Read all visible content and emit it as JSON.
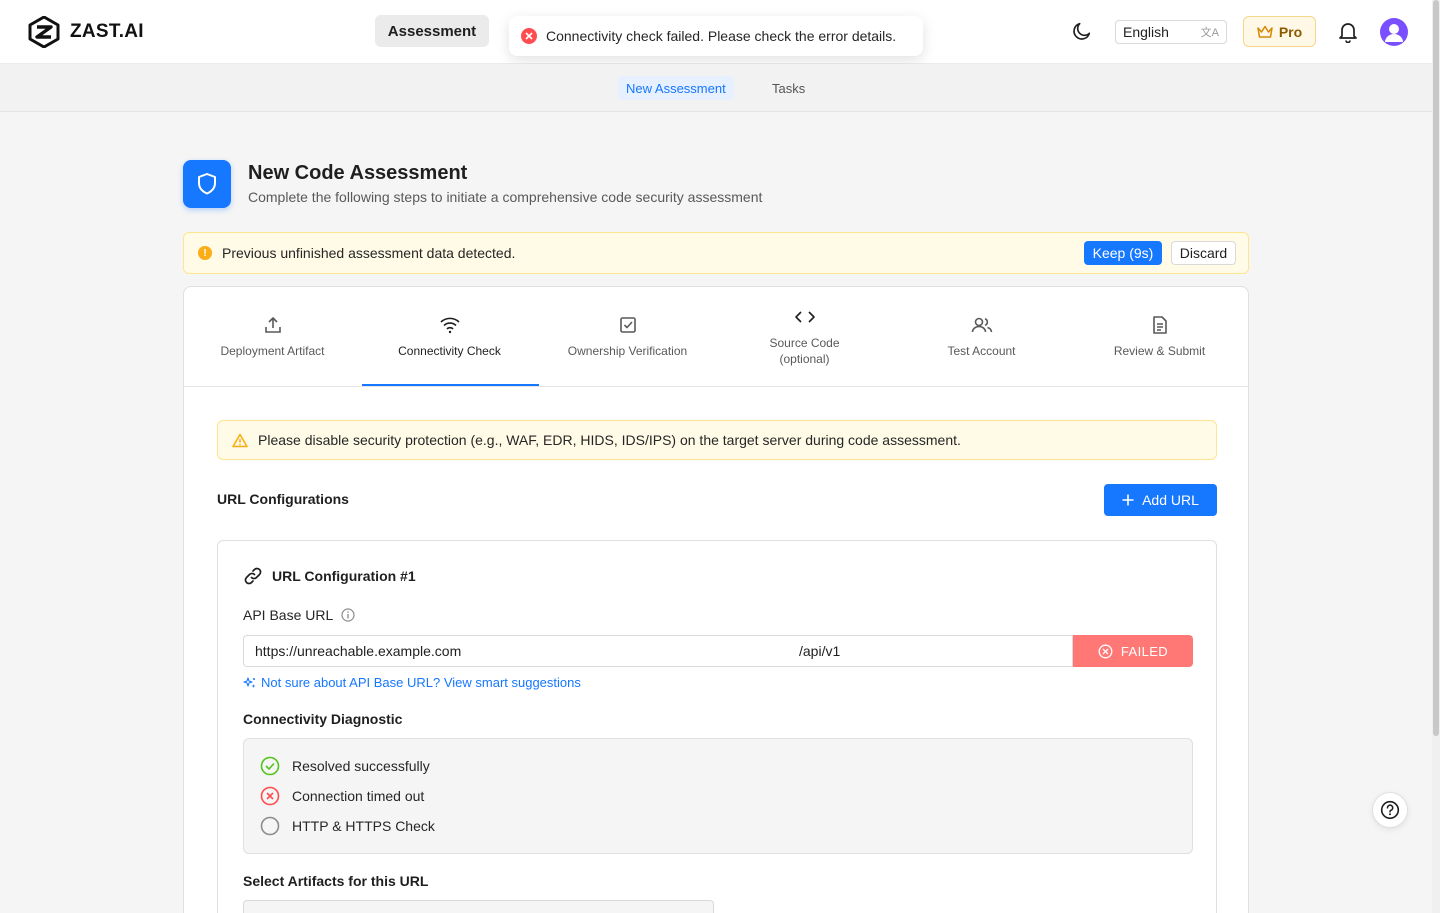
{
  "app": {
    "logo_text": "ZAST.AI"
  },
  "header": {
    "nav_button": "Assessment",
    "toast": "Connectivity check failed. Please check the error details.",
    "language": "English",
    "pro_label": "Pro"
  },
  "subnav": {
    "tabs": [
      {
        "label": "New Assessment"
      },
      {
        "label": "Tasks"
      }
    ]
  },
  "page": {
    "title": "New Code Assessment",
    "subtitle": "Complete the following steps to initiate a comprehensive code security assessment"
  },
  "banner": {
    "message": "Previous unfinished assessment data detected.",
    "keep_label": "Keep (9s)",
    "discard_label": "Discard"
  },
  "steps": [
    {
      "label": "Deployment Artifact",
      "icon": "upload-icon"
    },
    {
      "label": "Connectivity Check",
      "icon": "wifi-icon"
    },
    {
      "label": "Ownership Verification",
      "icon": "checkbox-icon"
    },
    {
      "label": "Source Code\n(optional)",
      "icon": "code-icon"
    },
    {
      "label": "Test Account",
      "icon": "users-icon"
    },
    {
      "label": "Review & Submit",
      "icon": "document-icon"
    }
  ],
  "alert": {
    "message": "Please disable security protection (e.g., WAF, EDR, HIDS, IDS/IPS) on the target server during code assessment."
  },
  "url_config": {
    "section_title": "URL Configurations",
    "add_label": "Add URL",
    "card_title": "URL Configuration #1",
    "base_url_label": "API Base URL",
    "base_url_value": "https://unreachable.example.com",
    "path_value": "/api/v1",
    "status_label": "FAILED",
    "suggest_link": "Not sure about API Base URL? View smart suggestions",
    "diagnostic_title": "Connectivity Diagnostic",
    "diagnostics": [
      {
        "label": "Resolved successfully",
        "status": "success"
      },
      {
        "label": "Connection timed out",
        "status": "error"
      },
      {
        "label": "HTTP & HTTPS Check",
        "status": "pending"
      }
    ],
    "artifacts_title": "Select Artifacts for this URL"
  },
  "colors": {
    "primary": "#1677ff",
    "error": "#ff4d4f",
    "warning": "#faad14",
    "success": "#52c41a"
  }
}
